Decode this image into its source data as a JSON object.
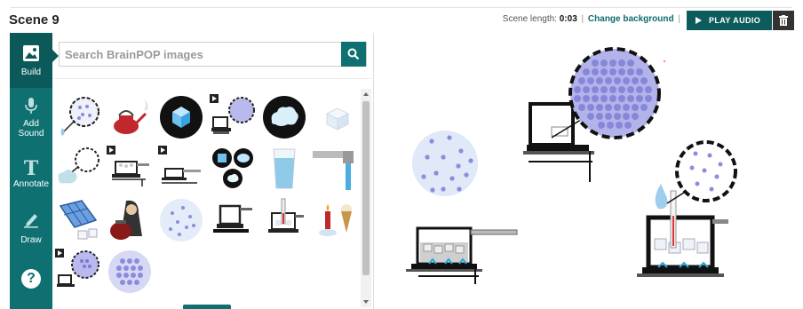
{
  "header": {
    "scene_title": "Scene 9",
    "scene_length_label": "Scene length:",
    "scene_length_value": "0:03",
    "separator": "|",
    "change_background": "Change background",
    "play_audio": "PLAY AUDIO"
  },
  "sidebar": {
    "items": [
      {
        "label": "Build",
        "icon": "image-icon"
      },
      {
        "label": "Add Sound",
        "icon": "microphone-icon"
      },
      {
        "label": "Annotate",
        "icon": "text-t-icon"
      },
      {
        "label": "Draw",
        "icon": "pencil-icon"
      }
    ],
    "help_glyph": "?"
  },
  "search": {
    "placeholder": "Search BrainPOP images",
    "value": ""
  },
  "thumbnails": [
    {
      "name": "magnified-particles-drop",
      "video": false
    },
    {
      "name": "red-kettle-steam",
      "video": false
    },
    {
      "name": "ice-cube-circle",
      "video": false
    },
    {
      "name": "stove-particles-zoom",
      "video": true
    },
    {
      "name": "steam-cloud-circle",
      "video": false
    },
    {
      "name": "melting-ice-cube",
      "video": false
    },
    {
      "name": "steam-magnified",
      "video": false
    },
    {
      "name": "pot-boiling-stove",
      "video": true
    },
    {
      "name": "pan-on-stove",
      "video": true
    },
    {
      "name": "three-states-circles",
      "video": false
    },
    {
      "name": "glass-of-water",
      "video": false
    },
    {
      "name": "faucet-running",
      "video": false
    },
    {
      "name": "ice-cube-tray",
      "video": false
    },
    {
      "name": "character-red-pot",
      "video": false
    },
    {
      "name": "liquid-particles-circle",
      "video": false
    },
    {
      "name": "pot-on-stove",
      "video": false
    },
    {
      "name": "thermometer-pot",
      "video": false
    },
    {
      "name": "candle-ice-cream",
      "video": false
    },
    {
      "name": "stove-solid-particles",
      "video": true
    },
    {
      "name": "solid-particles-circle",
      "video": false
    }
  ],
  "colors": {
    "teal": "#0e7070",
    "teal_dark": "#0b5959",
    "particle": "#8c8cde",
    "particle_light": "#b9b9ee"
  }
}
